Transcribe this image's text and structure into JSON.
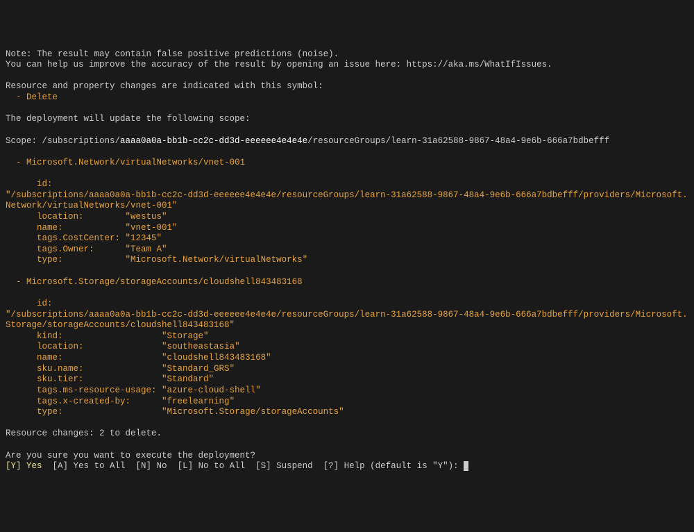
{
  "note_line1": "Note: The result may contain false positive predictions (noise).",
  "note_line2": "You can help us improve the accuracy of the result by opening an issue here: https://aka.ms/WhatIfIssues.",
  "changes_header": "Resource and property changes are indicated with this symbol:",
  "delete_symbol": "  - Delete",
  "scope_intro": "The deployment will update the following scope:",
  "scope_prefix": "Scope: /subscriptions/",
  "subscription_id": "aaaa0a0a-bb1b-cc2c-dd3d-eeeeee4e4e4e",
  "scope_suffix": "/resourceGroups/learn-31a62588-9867-48a4-9e6b-666a7bdbefff",
  "resource1": {
    "header": "  - Microsoft.Network/virtualNetworks/vnet-001",
    "id_label": "      id:             ",
    "id_value": "\"/subscriptions/aaaa0a0a-bb1b-cc2c-dd3d-eeeeee4e4e4e/resourceGroups/learn-31a62588-9867-48a4-9e6b-666a7bdbefff/providers/Microsoft.Network/virtualNetworks/vnet-001\"",
    "location_label": "      location:        ",
    "location_value": "\"westus\"",
    "name_label": "      name:            ",
    "name_value": "\"vnet-001\"",
    "tags_cc_label": "      tags.CostCenter: ",
    "tags_cc_value": "\"12345\"",
    "tags_owner_label": "      tags.Owner:      ",
    "tags_owner_value": "\"Team A\"",
    "type_label": "      type:            ",
    "type_value": "\"Microsoft.Network/virtualNetworks\""
  },
  "resource2": {
    "header": "  - Microsoft.Storage/storageAccounts/cloudshell843483168",
    "id_label": "      id:                     ",
    "id_value": "\"/subscriptions/aaaa0a0a-bb1b-cc2c-dd3d-eeeeee4e4e4e/resourceGroups/learn-31a62588-9867-48a4-9e6b-666a7bdbefff/providers/Microsoft.Storage/storageAccounts/cloudshell843483168\"",
    "kind_label": "      kind:                   ",
    "kind_value": "\"Storage\"",
    "location_label": "      location:               ",
    "location_value": "\"southeastasia\"",
    "name_label": "      name:                   ",
    "name_value": "\"cloudshell843483168\"",
    "sku_name_label": "      sku.name:               ",
    "sku_name_value": "\"Standard_GRS\"",
    "sku_tier_label": "      sku.tier:               ",
    "sku_tier_value": "\"Standard\"",
    "tags_usage_label": "      tags.ms-resource-usage: ",
    "tags_usage_value": "\"azure-cloud-shell\"",
    "tags_created_label": "      tags.x-created-by:      ",
    "tags_created_value": "\"freelearning\"",
    "type_label": "      type:                   ",
    "type_value": "\"Microsoft.Storage/storageAccounts\""
  },
  "summary": "Resource changes: 2 to delete.",
  "confirm_question": "Are you sure you want to execute the deployment?",
  "prompt": {
    "y_key": "[Y] Yes",
    "a_key": "  [A] Yes to All",
    "n_key": "  [N] No",
    "l_key": "  [L] No to All",
    "s_key": "  [S] Suspend",
    "h_key": "  [?] Help (default is \"Y\"): "
  }
}
